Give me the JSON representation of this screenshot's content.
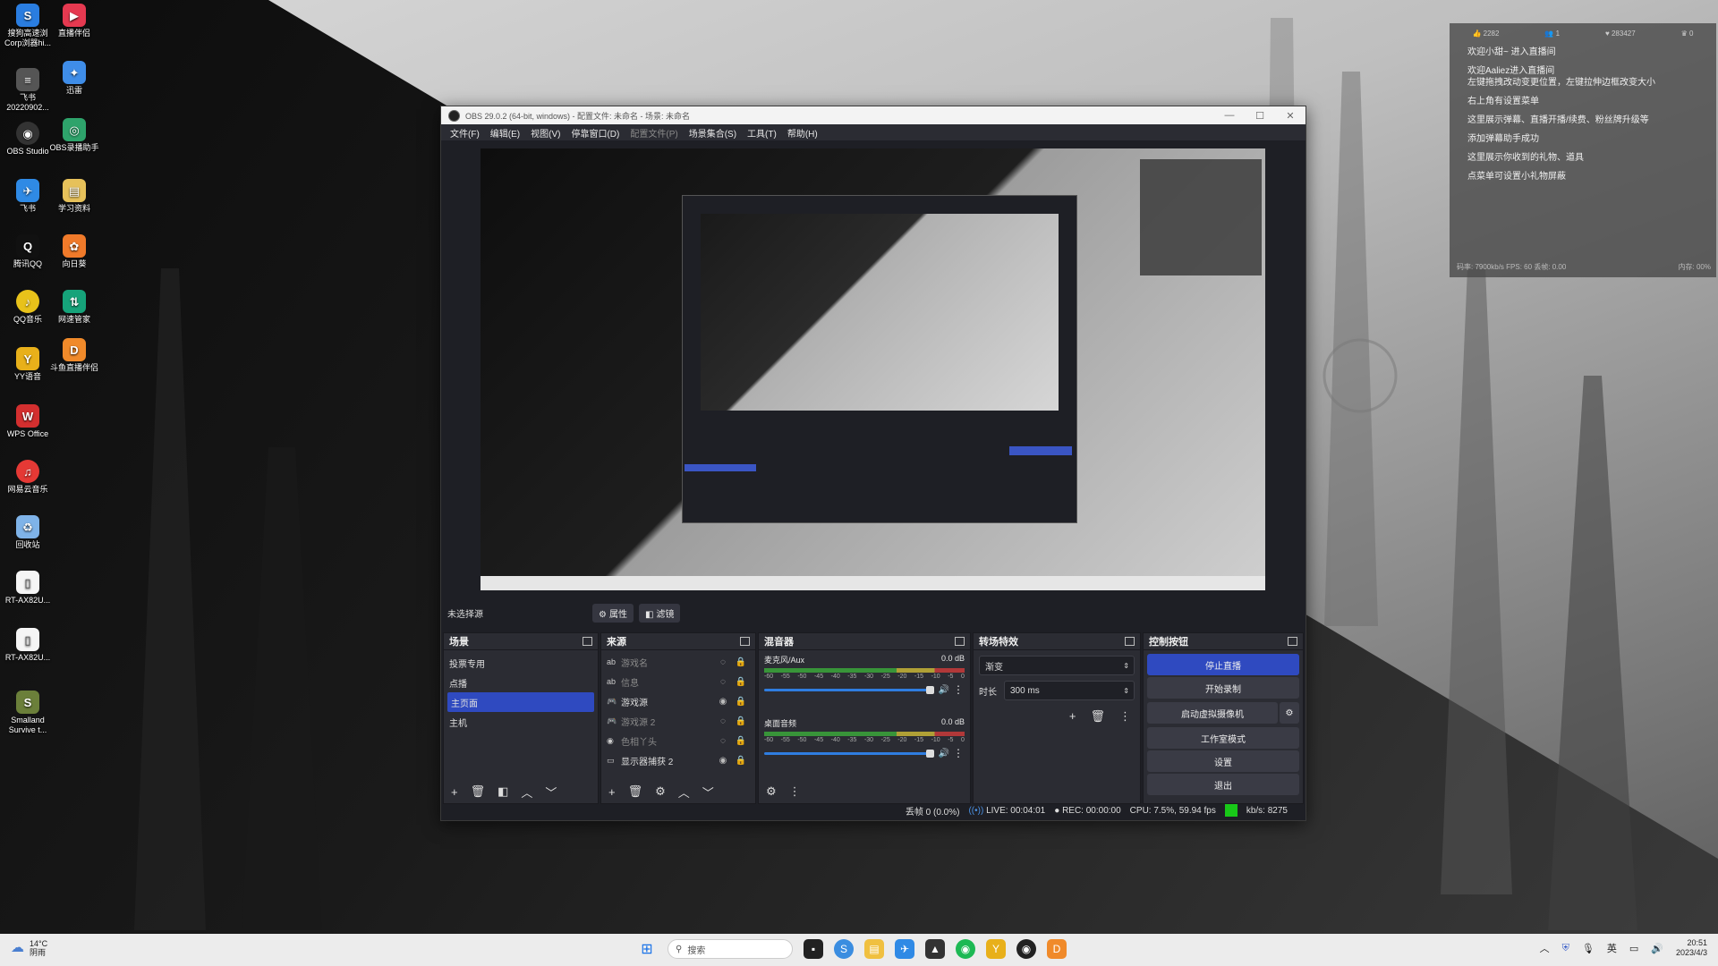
{
  "desktop": {
    "icons_left": [
      "搜狗高速浏Corp浏器hi...",
      "飞书20220902...",
      "OBS Studio",
      "飞书",
      "腾讯QQ",
      "QQ音乐",
      "YY语音",
      "WPS Office",
      "网易云音乐",
      "回收站",
      "RT-AX82U...",
      "RT-AX82U...",
      "Smalland Survive t..."
    ],
    "icons_right": [
      "直播伴侣",
      "迅雷",
      "OBS录播助手",
      "学习资料",
      "向日葵",
      "网速管家",
      "斗鱼直播伴侣"
    ]
  },
  "obs": {
    "title": "OBS 29.0.2 (64-bit, windows) - 配置文件: 未命名 - 场景: 未命名",
    "menu": [
      "文件(F)",
      "编辑(E)",
      "视图(V)",
      "停靠窗口(D)",
      "配置文件(P)",
      "场景集合(S)",
      "工具(T)",
      "帮助(H)"
    ],
    "source_bar": {
      "label": "未选择源",
      "properties": "属性",
      "filters": "滤镜"
    },
    "scenes": {
      "title": "场景",
      "items": [
        "投票专用",
        "点播",
        "主页面",
        "主机"
      ],
      "selected": 2
    },
    "sources": {
      "title": "来源",
      "items": [
        {
          "icon": "ab",
          "name": "游戏名",
          "visible": false
        },
        {
          "icon": "ab",
          "name": "信息",
          "visible": false
        },
        {
          "icon": "🎮",
          "name": "游戏源",
          "visible": true
        },
        {
          "icon": "🎮",
          "name": "游戏源 2",
          "visible": false
        },
        {
          "icon": "◉",
          "name": "色相丫头",
          "visible": false
        },
        {
          "icon": "▭",
          "name": "显示器捕获 2",
          "visible": true
        }
      ]
    },
    "mixer": {
      "title": "混音器",
      "tracks": [
        {
          "name": "麦克风/Aux",
          "db": "0.0 dB"
        },
        {
          "name": "桌面音频",
          "db": "0.0 dB"
        }
      ],
      "scale": [
        "-60",
        "-55",
        "-50",
        "-45",
        "-40",
        "-35",
        "-30",
        "-25",
        "-20",
        "-15",
        "-10",
        "-5",
        "0"
      ]
    },
    "transitions": {
      "title": "转场特效",
      "type": "渐变",
      "duration_label": "时长",
      "duration": "300 ms"
    },
    "controls": {
      "title": "控制按钮",
      "stop_stream": "停止直播",
      "start_record": "开始录制",
      "virtual_cam": "启动虚拟摄像机",
      "studio_mode": "工作室模式",
      "settings": "设置",
      "exit": "退出"
    },
    "status": {
      "dropped": "丢帧 0 (0.0%)",
      "live": "LIVE: 00:04:01",
      "rec": "REC: 00:00:00",
      "cpu": "CPU: 7.5%, 59.94 fps",
      "kbps": "kb/s: 8275"
    }
  },
  "chat": {
    "stats": [
      "2282",
      "1",
      "283427",
      "0"
    ],
    "lines": [
      "欢迎小甜~ 进入直播间",
      "欢迎Aaliez进入直播间\n左键拖拽改动变更位置，左键拉伸边框改变大小",
      "右上角有设置菜单",
      "这里展示弹幕、直播开播/续费、粉丝牌升级等",
      "添加弹幕助手成功",
      "这里展示你收到的礼物、道具",
      "点菜单可设置小礼物屏蔽"
    ],
    "footer_left": "码率: 7900kb/s FPS: 60 丢帧: 0.00",
    "footer_right": "内存: 00%"
  },
  "taskbar": {
    "weather_temp": "14°C",
    "weather_desc": "阴雨",
    "search_placeholder": "搜索",
    "time": "20:51",
    "date": "2023/4/3",
    "ime": "英"
  }
}
